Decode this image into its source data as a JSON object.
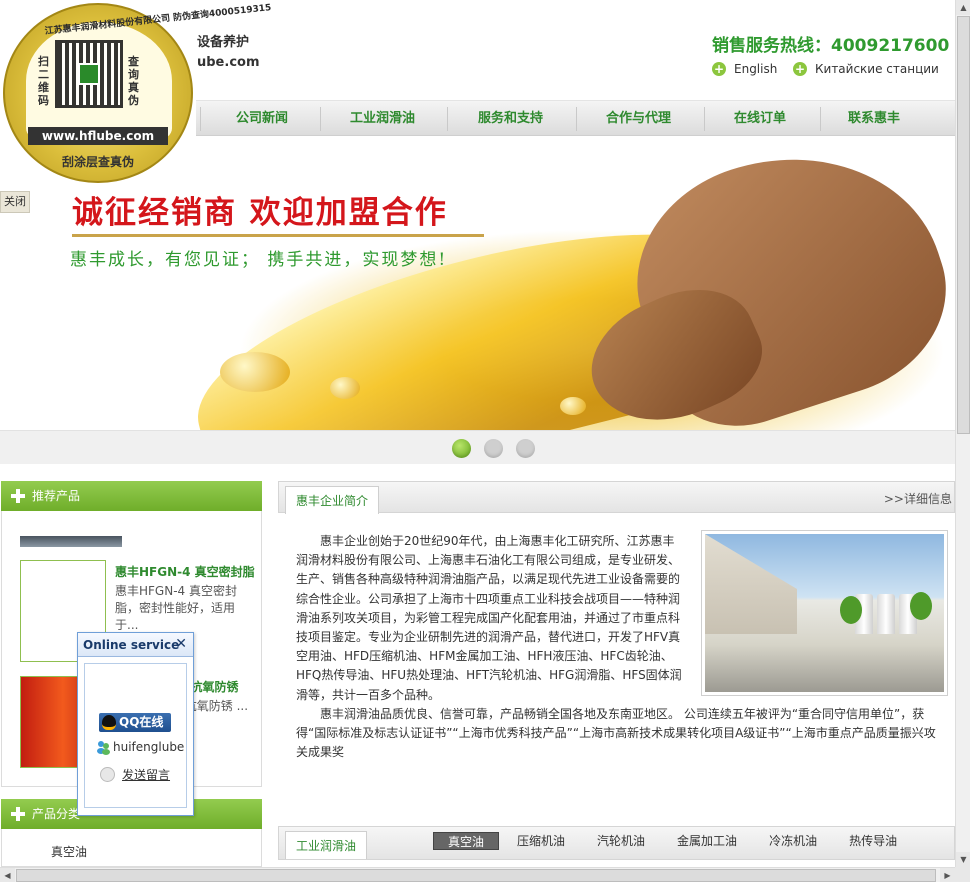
{
  "header": {
    "logo_line1": "设备养护",
    "logo_line2": "ube.com",
    "hotline": "销售服务热线：4009217600",
    "lang_english": "English",
    "lang_russian": "Китайские станции"
  },
  "seal": {
    "top_text": "江苏惠丰润滑材料股份有限公司 防伪查询4000519315",
    "left_text": "扫二维码",
    "right_text": "查询真伪",
    "url": "www.hflube.com",
    "bottom_text": "刮涂层查真伪",
    "close_label": "关闭"
  },
  "nav": {
    "items": [
      "公司新闻",
      "工业润滑油",
      "服务和支持",
      "合作与代理",
      "在线订单",
      "联系惠丰"
    ]
  },
  "banner": {
    "title": "诚征经销商  欢迎加盟合作",
    "subtitle": "惠丰成长，有您见证；  携手共进，实现梦想!",
    "slides": 3,
    "active_slide": 1
  },
  "recommended": {
    "title": "推荐产品",
    "products": [
      {
        "title": "惠丰HFGN-4 真空密封脂",
        "desc": "惠丰HFGN-4 真空密封脂，密封性能好，适用于..."
      },
      {
        "title": "惠丰HFT-NL 抗氧防锈",
        "desc": "惠丰HFT-NL 抗氧防锈 ..."
      }
    ]
  },
  "categories": {
    "title": "产品分类",
    "first_item": "真空油"
  },
  "intro": {
    "tab": "惠丰企业简介",
    "more": ">>详细信息",
    "p1": "惠丰企业创始于20世纪90年代，由上海惠丰化工研究所、江苏惠丰润滑材料股份有限公司、上海惠丰石油化工有限公司组成，是专业研发、生产、销售各种高级特种润滑油脂产品，以满足现代先进工业设备需要的综合性企业。公司承担了上海市十四项重点工业科技会战项目——特种润滑油系列攻关项目，为彩管工程完成国产化配套用油，并通过了市重点科技项目鉴定。专业为企业研制先进的润滑产品，替代进口，开发了HFV真空用油、HFD压缩机油、HFM金属加工油、HFH液压油、HFC齿轮油、HFQ热传导油、HFU热处理油、HFT汽轮机油、HFG润滑脂、HFS固体润滑等，共计一百多个品种。",
    "p2": "惠丰润滑油品质优良、信誉可靠，产品畅销全国各地及东南亚地区。 公司连续五年被评为“重合同守信用单位”，获得“国际标准及标志认证证书”“上海市优秀科技产品”“上海市高新技术成果转化项目A级证书”“上海市重点产品质量振兴攻关成果奖"
  },
  "lubricants": {
    "tab": "工业润滑油",
    "subtabs": [
      "真空油",
      "压缩机油",
      "汽轮机油",
      "金属加工油",
      "冷冻机油",
      "热传导油"
    ],
    "active": 0
  },
  "online": {
    "title": "Online service",
    "qq_label": "QQ在线",
    "msn_label": "huifenglube",
    "message_label": "发送留言",
    "overlay_text": "惠丰"
  },
  "colors": {
    "brand_green": "#2f9a2f",
    "accent_green": "#6fae2a",
    "banner_red": "#d4161b"
  }
}
